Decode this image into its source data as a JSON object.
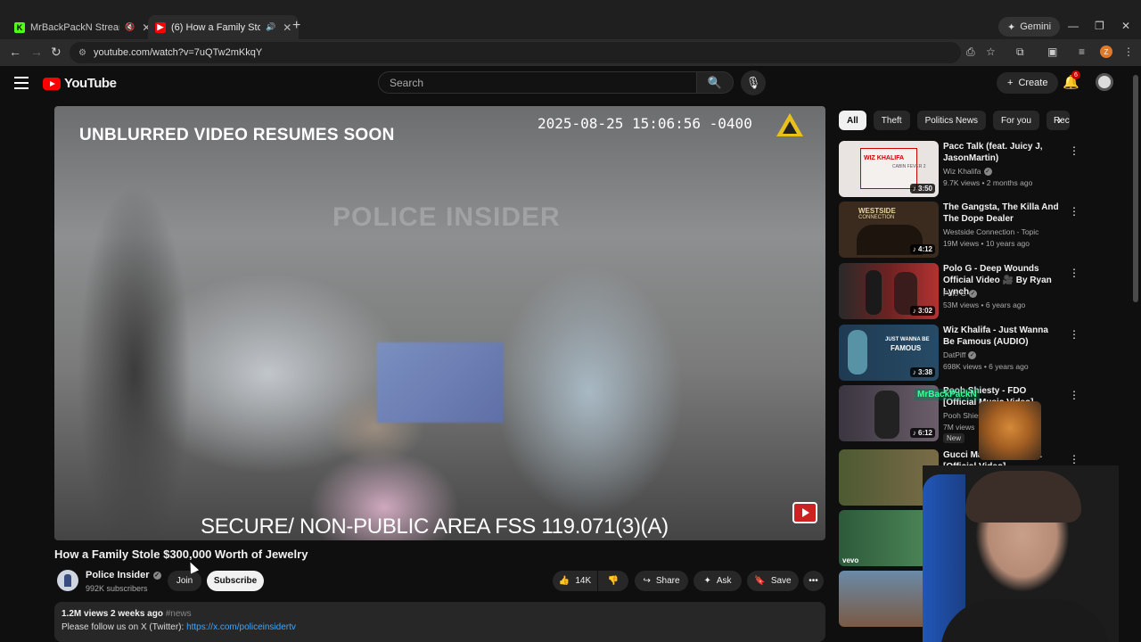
{
  "browser": {
    "tabs": [
      {
        "title": "MrBackPackN Stream - Wa",
        "favicon_color": "#53fc18",
        "favicon_letter": "K",
        "active": false
      },
      {
        "title": "(6) How a Family Stole $30",
        "favicon_color": "#ff0000",
        "favicon_letter": "▶",
        "active": true
      }
    ],
    "gemini_label": "Gemini",
    "url": "youtube.com/watch?v=7uQTw2mKkqY",
    "profile_letter": "Z"
  },
  "yt": {
    "logo_text": "YouTube",
    "search_placeholder": "Search",
    "create_label": "Create",
    "notification_count": "6"
  },
  "video": {
    "overlay_top": "UNBLURRED VIDEO RESUMES SOON",
    "timestamp": "2025-08-25 15:06:56 -0400",
    "watermark": "POLICE INSIDER",
    "overlay_bottom": "SECURE/ NON-PUBLIC AREA FSS 119.071(3)(A)",
    "title": "How a Family Stole $300,000 Worth of Jewelry",
    "channel": "Police Insider",
    "subscribers": "992K subscribers",
    "join_label": "Join",
    "subscribe_label": "Subscribe",
    "likes": "14K",
    "share_label": "Share",
    "ask_label": "Ask",
    "save_label": "Save",
    "views_date": "1.2M views  2 weeks ago",
    "hashtag": "#news",
    "follow_text": "Please follow us on X (Twitter): ",
    "follow_link": "https://x.com/policeinsidertv"
  },
  "chips": [
    "All",
    "Theft",
    "Politics News",
    "For you",
    "Rec"
  ],
  "recommendations": [
    {
      "title": "Pacc Talk (feat. Juicy J, JasonMartin)",
      "channel": "Wiz Khalifa",
      "verified": true,
      "meta": "9.7K views • 2 months ago",
      "duration": "♪ 3:50",
      "thumb_label": "WIZ KHALIFA",
      "thumb_sub": "CABIN FEVER 2",
      "thumb_bg": "#e9e4e2"
    },
    {
      "title": "The Gangsta, The Killa And The Dope Dealer",
      "channel": "Westside Connection - Topic",
      "verified": false,
      "meta": "19M views • 10 years ago",
      "duration": "♪ 4:12",
      "thumb_label": "WESTSIDE",
      "thumb_sub": "CONNECTION",
      "thumb_bg": "#3a2b1e"
    },
    {
      "title": "Polo G - Deep Wounds Official Video 🎥 By Ryan Lynch",
      "channel": "Polo G",
      "verified": true,
      "meta": "53M views • 6 years ago",
      "duration": "♪ 3:02",
      "thumb_label": "",
      "thumb_sub": "",
      "thumb_bg": "#8c2b2b"
    },
    {
      "title": "Wiz Khalifa - Just Wanna Be Famous (AUDIO)",
      "channel": "DatPiff",
      "verified": true,
      "meta": "698K views • 6 years ago",
      "duration": "♪ 3:38",
      "thumb_label": "JUST WANNA BE",
      "thumb_sub": "FAMOUS",
      "thumb_bg": "#2c4a6b"
    },
    {
      "title": "Pooh Shiesty - FDO [Official Music Video]",
      "channel": "Pooh Shiesty",
      "verified": false,
      "meta": "7M views",
      "duration": "♪ 6:12",
      "thumb_label": "",
      "thumb_sub": "",
      "thumb_bg": "#5a4a55",
      "new": "New"
    },
    {
      "title": "Gucci Mane - ... ft. Lil ... [Official Video]",
      "channel": "",
      "verified": false,
      "meta": "",
      "duration": "",
      "thumb_label": "",
      "thumb_sub": "",
      "thumb_bg": "#5e6b3d"
    },
    {
      "title": "",
      "channel": "",
      "verified": false,
      "meta": "",
      "duration": "",
      "thumb_label": "vevo",
      "thumb_sub": "",
      "thumb_bg": "#2d5a3a"
    }
  ],
  "stream_overlay": "MrBackPackN"
}
